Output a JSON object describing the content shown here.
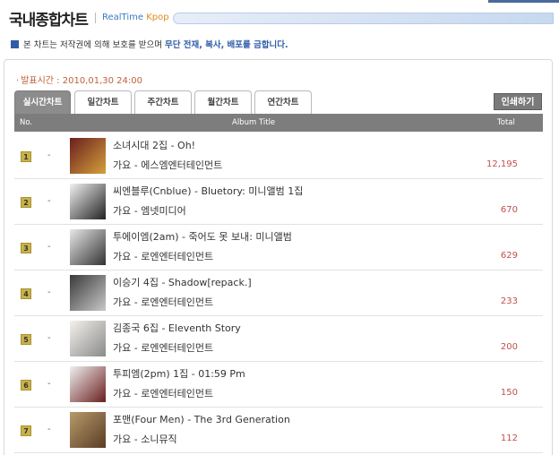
{
  "header": {
    "title": "국내종합차트",
    "subtitle_prefix": "RealTime ",
    "subtitle_suffix": "Kpop"
  },
  "notice": {
    "text": "본 차트는 저작권에 의해 보호를 받으며 ",
    "emphasis": "무단 전재, 복사, 배포를 금합니다."
  },
  "release": {
    "label": "발표시간",
    "value": "2010,01,30 24:00"
  },
  "tabs": [
    {
      "label": "실시간차트",
      "active": true
    },
    {
      "label": "일간차트",
      "active": false
    },
    {
      "label": "주간차트",
      "active": false
    },
    {
      "label": "월간차트",
      "active": false
    },
    {
      "label": "연간차트",
      "active": false
    }
  ],
  "print_label": "인쇄하기",
  "columns": {
    "no": "No.",
    "album": "Album Title",
    "total": "Total"
  },
  "rows": [
    {
      "rank": "1",
      "change": "-",
      "title": "소녀시대 2집 - Oh!",
      "sub": "가요 - 에스엠엔터테인먼트",
      "total": "12,195",
      "cover": [
        "#6a1f1f",
        "#d4a03a"
      ]
    },
    {
      "rank": "2",
      "change": "-",
      "title": "씨엔블루(Cnblue) - Bluetory: 미니앨범 1집",
      "sub": "가요 - 엠넷미디어",
      "total": "670",
      "cover": [
        "#f2f2f2",
        "#222222"
      ]
    },
    {
      "rank": "3",
      "change": "-",
      "title": "투에이엠(2am) - 죽어도 못 보내: 미니앨범",
      "sub": "가요 - 로엔엔터테인먼트",
      "total": "629",
      "cover": [
        "#e8e8e8",
        "#333333"
      ]
    },
    {
      "rank": "4",
      "change": "-",
      "title": "이승기 4집 - Shadow[repack.]",
      "sub": "가요 - 로엔엔터테인먼트",
      "total": "233",
      "cover": [
        "#3a3a3a",
        "#c8c8c8"
      ]
    },
    {
      "rank": "5",
      "change": "-",
      "title": "김종국 6집 - Eleventh Story",
      "sub": "가요 - 로엔엔터테인먼트",
      "total": "200",
      "cover": [
        "#f4f1ec",
        "#8a8a8a"
      ]
    },
    {
      "rank": "6",
      "change": "-",
      "title": "투피엠(2pm) 1집 - 01:59 Pm",
      "sub": "가요 - 로엔엔터테인먼트",
      "total": "150",
      "cover": [
        "#f0f0f0",
        "#6b1f1f"
      ]
    },
    {
      "rank": "7",
      "change": "-",
      "title": "포맨(Four Men) - The 3rd Generation",
      "sub": "가요 - 소니뮤직",
      "total": "112",
      "cover": [
        "#b79a6a",
        "#5a3d24"
      ]
    }
  ]
}
